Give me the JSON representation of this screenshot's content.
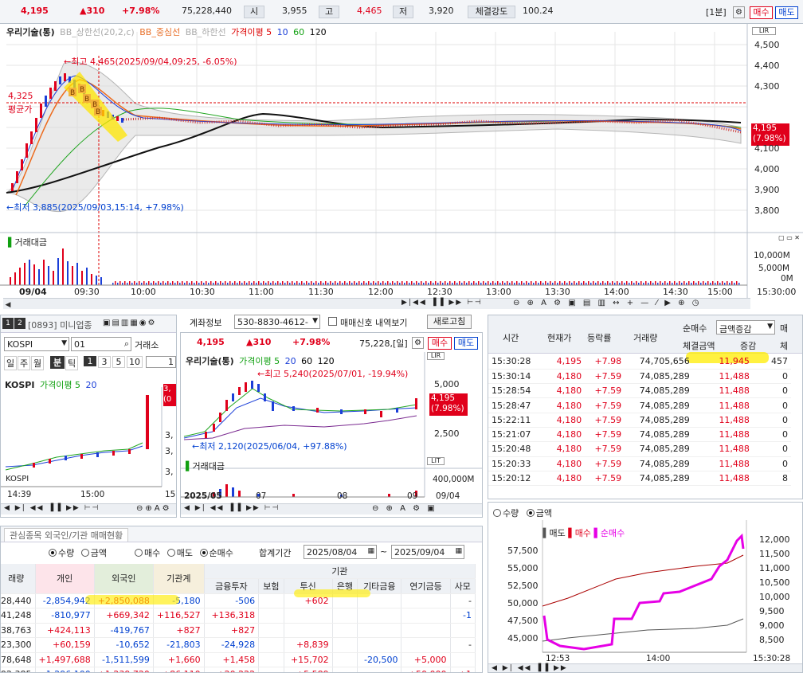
{
  "quote_bar": {
    "price": "4,195",
    "change": "▲310",
    "change_pct": "+7.98%",
    "volume": "75,228,440",
    "open_label": "시",
    "open": "3,955",
    "high_label": "고",
    "high": "4,465",
    "low_label": "저",
    "low": "3,920",
    "strength_label": "체결강도",
    "strength": "100.24",
    "interval": "[1분]",
    "buy": "매수",
    "sell": "매도"
  },
  "main_chart": {
    "legend": {
      "name": "우리기술(통)",
      "bb_upper": "BB_상한선(20,2,c)",
      "bb_mid": "BB_중심선",
      "bb_lower": "BB_하한선",
      "ma": "가격이평 5",
      "ma10": "10",
      "ma60": "60",
      "ma120": "120"
    },
    "high_annotation": "←최고 4,465(2025/09/04,09:25, -6.05%)",
    "low_annotation": "←최저 3,885(2025/09/03,15:14, +7.98%)",
    "avg_price": "4,325",
    "avg_label": "평균가",
    "price_tag": "4,195",
    "price_tag_pct": "(7.98%)",
    "y_ticks": [
      "4,500",
      "4,400",
      "4,300",
      "4,100",
      "4,000",
      "3,900",
      "3,800"
    ],
    "volume_label": "거래대금",
    "volume_ticks": [
      "10,000M",
      "5,000M",
      "0M"
    ],
    "x_ticks": [
      "09/04",
      "09:30",
      "10:00",
      "10:30",
      "11:00",
      "11:30",
      "12:00",
      "12:30",
      "13:00",
      "13:30",
      "14:00",
      "14:30",
      "15:00"
    ],
    "time_label": "15:30:00"
  },
  "mini_window": {
    "code": "[0893] 미니업종",
    "market": "KOSPI",
    "code_input": "01",
    "exchange": "거래소",
    "periods": [
      "일",
      "주",
      "월",
      "분",
      "틱"
    ],
    "nums": [
      "1",
      "3",
      "5",
      "10"
    ],
    "count": "1",
    "legend": "KOSPI",
    "ma": "가격이평 5",
    "ma20": "20",
    "y_ticks": [
      "3,",
      "3,",
      "3,"
    ],
    "price_tag_a": "3,",
    "price_tag_b": "(0",
    "x_ticks": [
      "14:39",
      "15:00",
      "15"
    ]
  },
  "account_bar": {
    "label": "계좌정보",
    "account": "530-8830-4612-",
    "signal": "매매신호 내역보기",
    "refresh": "새로고침"
  },
  "daily_chart": {
    "price": "4,195",
    "change": "▲310",
    "change_pct": "+7.98%",
    "volume": "75,228,[일]",
    "buy": "매수",
    "sell": "매도",
    "legend": "우리기술(통)",
    "ma": "가격이평 5",
    "ma20": "20",
    "ma60": "60",
    "ma120": "120",
    "high_annotation": "←최고 5,240(2025/07/01, -19.94%)",
    "low_annotation": "←최저 2,120(2025/06/04, +97.88%)",
    "y_ticks": [
      "5,000",
      "2,500"
    ],
    "price_tag": "4,195",
    "price_tag_pct": "(7.98%)",
    "volume_label": "거래대금",
    "volume_tick": "400,000M",
    "x_ticks": [
      "2025/05",
      "07",
      "08",
      "09",
      "09/04"
    ]
  },
  "trades": {
    "headers": [
      "시간",
      "현재가",
      "등락률",
      "거래량",
      "순매수",
      "금액증감",
      "매"
    ],
    "subheaders": [
      "체결금액",
      "증감",
      "체"
    ],
    "rows": [
      [
        "15:30:28",
        "4,195",
        "+7.98",
        "74,705,656",
        "11,945",
        "457"
      ],
      [
        "15:30:14",
        "4,180",
        "+7.59",
        "74,085,289",
        "11,488",
        "0"
      ],
      [
        "15:28:54",
        "4,180",
        "+7.59",
        "74,085,289",
        "11,488",
        "0"
      ],
      [
        "15:28:47",
        "4,180",
        "+7.59",
        "74,085,289",
        "11,488",
        "0"
      ],
      [
        "15:22:11",
        "4,180",
        "+7.59",
        "74,085,289",
        "11,488",
        "0"
      ],
      [
        "15:21:07",
        "4,180",
        "+7.59",
        "74,085,289",
        "11,488",
        "0"
      ],
      [
        "15:20:48",
        "4,180",
        "+7.59",
        "74,085,289",
        "11,488",
        "0"
      ],
      [
        "15:20:33",
        "4,180",
        "+7.59",
        "74,085,289",
        "11,488",
        "0"
      ],
      [
        "15:20:12",
        "4,180",
        "+7.59",
        "74,085,289",
        "11,488",
        "8"
      ]
    ],
    "mode_qty": "수량",
    "mode_amt": "금액"
  },
  "net_chart": {
    "legend_sell": "매도",
    "legend_buy": "매수",
    "legend_net": "순매수",
    "left_ticks": [
      "57,500",
      "55,000",
      "52,500",
      "50,000",
      "47,500",
      "45,000"
    ],
    "right_ticks": [
      "12,000",
      "11,500",
      "11,000",
      "10,500",
      "10,000",
      "9,500",
      "9,000",
      "8,500"
    ],
    "x_ticks": [
      "12:53",
      "14:00",
      "15:30:28"
    ]
  },
  "investor": {
    "tab": "관심종목 외국인/기관 매매현황",
    "r_qty": "수량",
    "r_amt": "금액",
    "r_buy": "매수",
    "r_sell": "매도",
    "r_net": "순매수",
    "period_label": "합계기간",
    "date_from": "2025/08/04",
    "date_to": "2025/09/04",
    "group_header": "기관",
    "headers": [
      "래량",
      "개인",
      "외국인",
      "기관계",
      "금융투자",
      "보험",
      "투신",
      "은행",
      "기타금융",
      "연기금등",
      "사모"
    ],
    "rows": [
      [
        "28,440",
        "-2,854,942",
        "+2,850,088",
        "-5,180",
        "-506",
        "",
        "+602",
        "",
        "",
        "",
        "-"
      ],
      [
        "41,248",
        "-810,977",
        "+669,342",
        "+116,527",
        "+136,318",
        "",
        "",
        "",
        "",
        "",
        "-1"
      ],
      [
        "38,763",
        "+424,113",
        "-419,767",
        "+827",
        "+827",
        "",
        "",
        "",
        "",
        "",
        ""
      ],
      [
        "23,300",
        "+60,159",
        "-10,652",
        "-21,803",
        "-24,928",
        "",
        "+8,839",
        "",
        "",
        "",
        "-"
      ],
      [
        "78,648",
        "+1,497,688",
        "-1,511,599",
        "+1,660",
        "+1,458",
        "",
        "+15,702",
        "",
        "-20,500",
        "+5,000",
        ""
      ],
      [
        "92,385",
        "-1,296,100",
        "+1,239,720",
        "+86,110",
        "+20,222",
        "",
        "+5,589",
        "",
        "",
        "+50,000",
        "+1"
      ]
    ]
  },
  "colors": {
    "up": "#e0001b",
    "down": "#0040d0",
    "net": "#e600e6",
    "highlight": "#ffe600"
  }
}
